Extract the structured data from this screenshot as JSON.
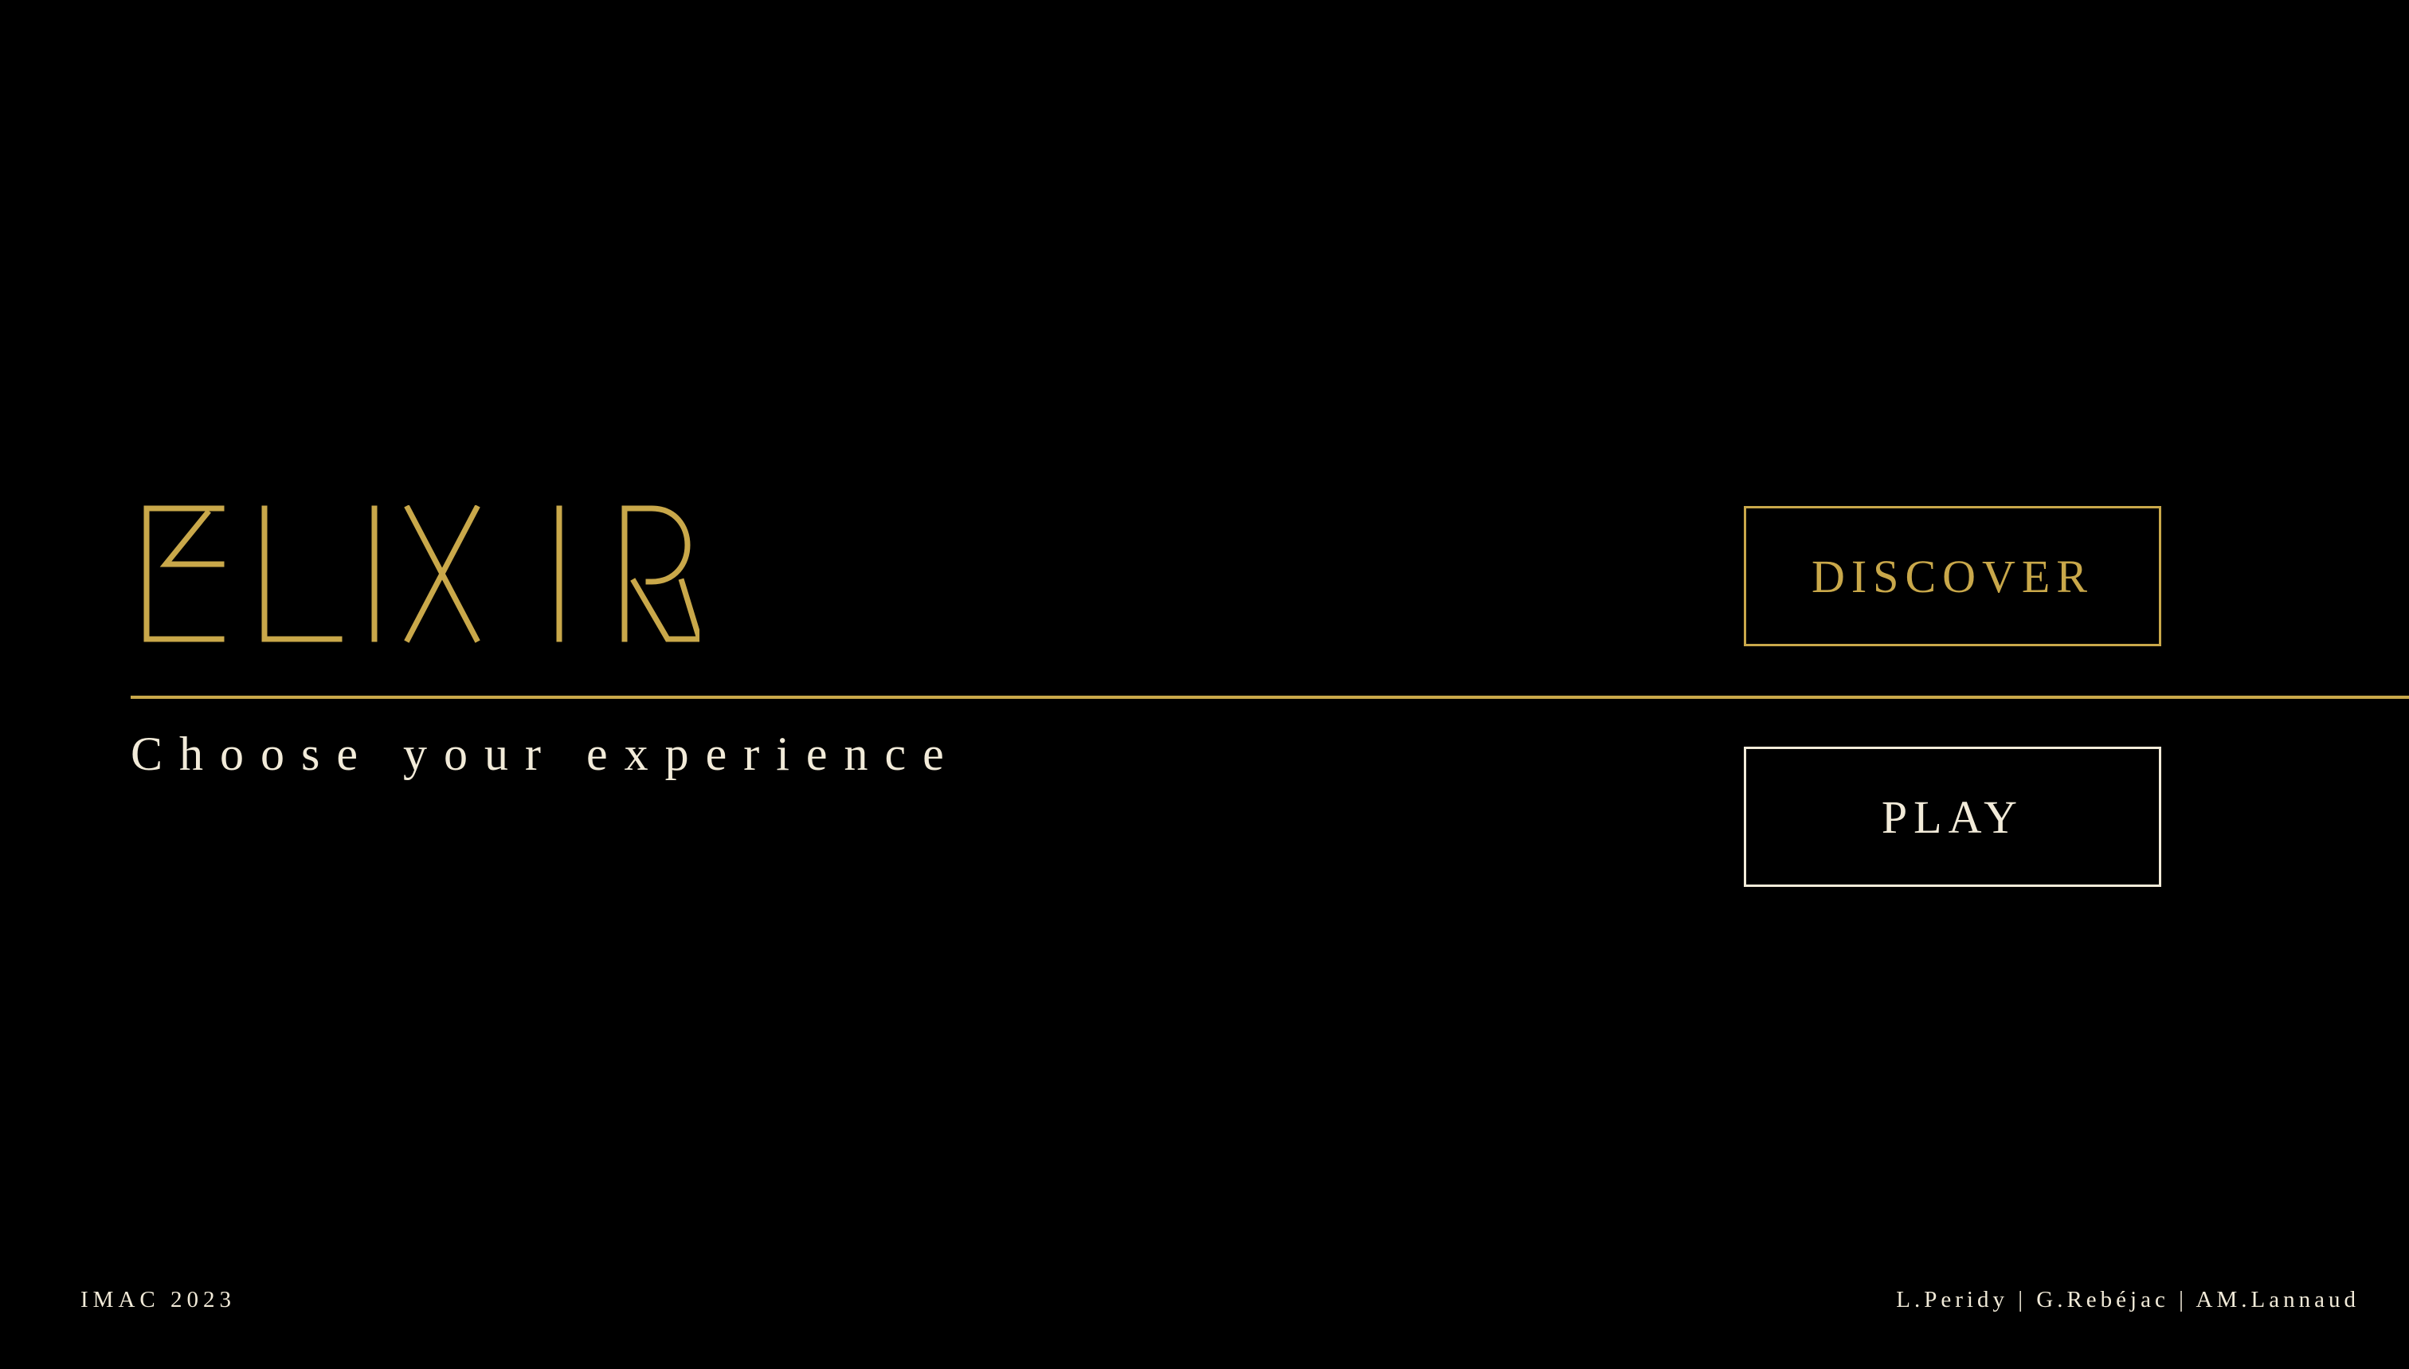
{
  "app": {
    "logo_text": "ELIXIR",
    "tagline": "Choose your experience"
  },
  "menu": {
    "discover_label": "DISCOVER",
    "play_label": "PLAY"
  },
  "footer": {
    "year_label": "IMAC 2023",
    "credits": "L.Peridy | G.Rebéjac | AM.Lannaud"
  },
  "colors": {
    "background": "#000000",
    "gold": "#c9a84a",
    "cream": "#f2ebd9"
  }
}
